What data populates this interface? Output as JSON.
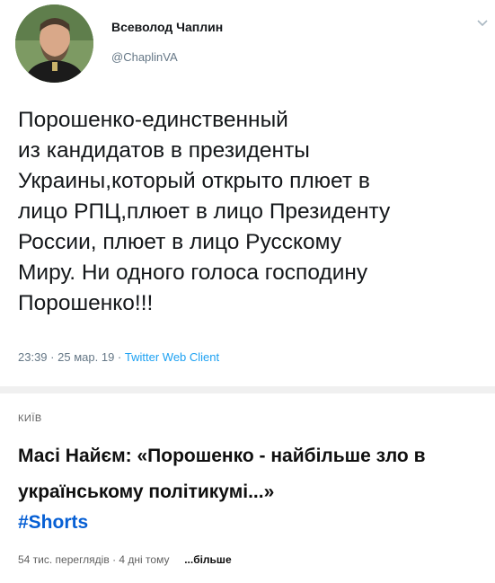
{
  "tweet": {
    "author_name": "Всеволод Чаплин",
    "author_handle": "@ChaplinVA",
    "text": "Порошенко-единственный\nиз кандидатов в президенты\nУкраины,который открыто плюет  в\nлицо РПЦ,плюет в лицо Президенту\nРоссии, плюет в лицо Русскому\nМиру. Ни одного голоса господину\nПорошенко!!!",
    "time": "23:39",
    "date": "25 мар. 19",
    "source": "Twitter Web Client",
    "separator": "·",
    "icons": {
      "avatar": "avatar-photo",
      "menu": "chevron-down-icon"
    }
  },
  "video": {
    "location": "КИЇВ",
    "title": "Масі Найєм: «Порошенко - найбільше зло в українському політикумі...»",
    "hashtag": "#Shorts",
    "views": "54 тис. переглядів",
    "age": "4 дні тому",
    "more_label": "...більше"
  },
  "colors": {
    "twitter_link": "#1da1f2",
    "youtube_link": "#065fd4",
    "muted": "#657786"
  }
}
